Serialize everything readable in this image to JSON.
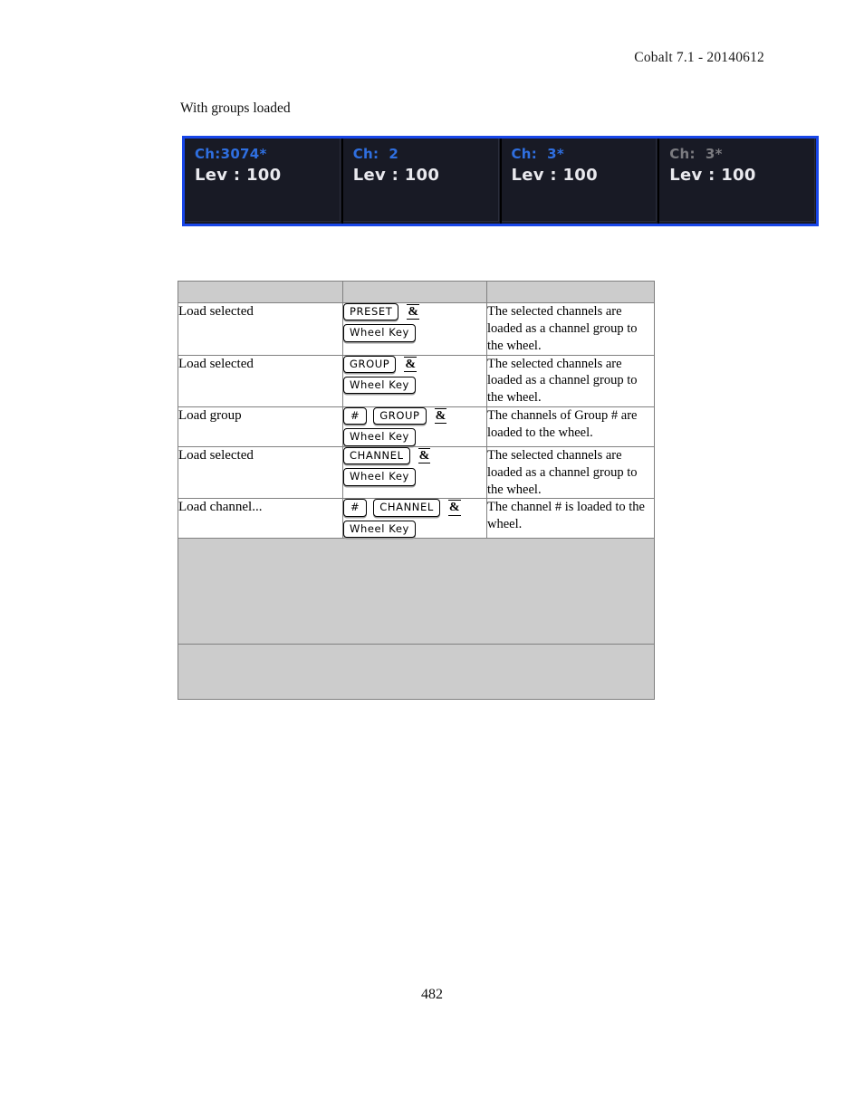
{
  "header": {
    "running_head": "Cobalt 7.1 - 20140612"
  },
  "caption": "With groups loaded",
  "console": {
    "border_color": "#1846e8",
    "cell_bg": "#181a25",
    "active_color": "#2f6fe0",
    "dim_color": "#7b7b80",
    "level_color": "#e9e9ee",
    "cells": [
      {
        "channel": "Ch:3074*",
        "level": "Lev : 100",
        "state": "active"
      },
      {
        "channel": "Ch:  2",
        "level": "Lev : 100",
        "state": "active"
      },
      {
        "channel": "Ch:  3*",
        "level": "Lev : 100",
        "state": "active"
      },
      {
        "channel": "Ch:  3*",
        "level": "Lev : 100",
        "state": "dim"
      }
    ]
  },
  "table": {
    "headers": [
      "",
      "",
      ""
    ],
    "rows": [
      {
        "action": "Load selected",
        "keys_line1": [
          {
            "type": "keycap",
            "label": "PRESET"
          },
          {
            "type": "amp",
            "label": "&"
          }
        ],
        "keys_line2": [
          {
            "type": "keycap",
            "label": "Wheel Key"
          }
        ],
        "description": "The selected channels are loaded as a channel group to the wheel."
      },
      {
        "action": "Load selected",
        "keys_line1": [
          {
            "type": "keycap",
            "label": "GROUP"
          },
          {
            "type": "amp",
            "label": "&"
          }
        ],
        "keys_line2": [
          {
            "type": "keycap",
            "label": "Wheel Key"
          }
        ],
        "description": "The selected channels are loaded as a channel group to the wheel."
      },
      {
        "action": "Load group",
        "keys_line1": [
          {
            "type": "keycap",
            "label": "#"
          },
          {
            "type": "keycap",
            "label": "GROUP"
          },
          {
            "type": "amp",
            "label": "&"
          }
        ],
        "keys_line2": [
          {
            "type": "keycap",
            "label": "Wheel Key"
          }
        ],
        "description": "The channels of Group # are loaded to the wheel."
      },
      {
        "action": "Load selected",
        "keys_line1": [
          {
            "type": "keycap",
            "label": "CHANNEL"
          },
          {
            "type": "amp",
            "label": "&"
          }
        ],
        "keys_line2": [
          {
            "type": "keycap",
            "label": "Wheel Key"
          }
        ],
        "description": "The selected channels are loaded as a channel group to the wheel."
      },
      {
        "action": "Load channel...",
        "keys_line1": [
          {
            "type": "keycap",
            "label": "#"
          },
          {
            "type": "keycap",
            "label": "CHANNEL"
          },
          {
            "type": "amp",
            "label": "&"
          }
        ],
        "keys_line2": [
          {
            "type": "keycap",
            "label": "Wheel Key"
          }
        ],
        "description": "The channel # is loaded to the wheel."
      }
    ],
    "filler_rows": [
      {
        "label": "",
        "height": "tall"
      },
      {
        "label": "",
        "height": "short"
      }
    ]
  },
  "page_number": "482"
}
